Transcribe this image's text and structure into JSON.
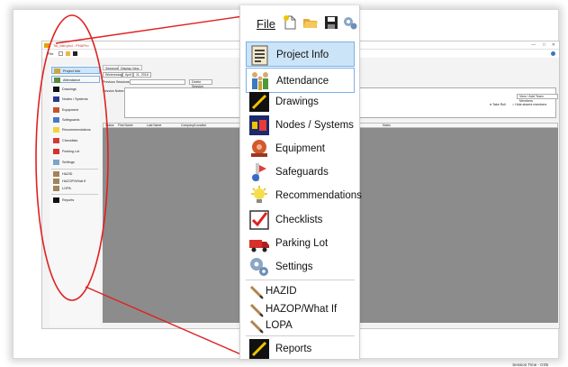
{
  "app": {
    "title": "Tst_fast.phd - PHAPro",
    "menu_file": "File",
    "window_controls": [
      "—",
      "□",
      "✕"
    ]
  },
  "nav_small": [
    {
      "label": "Project Info",
      "icon": "project-info-icon",
      "state": "active"
    },
    {
      "label": "Attendance",
      "icon": "attendance-icon",
      "state": "outlined"
    },
    {
      "label": "Drawings",
      "icon": "drawings-icon"
    },
    {
      "label": "Nodes / Systems",
      "icon": "nodes-systems-icon"
    },
    {
      "label": "Equipment",
      "icon": "equipment-icon"
    },
    {
      "label": "Safeguards",
      "icon": "safeguards-icon"
    },
    {
      "label": "Recommendations",
      "icon": "recommendations-icon"
    },
    {
      "label": "Checklists",
      "icon": "checklists-icon"
    },
    {
      "label": "Parking Lot",
      "icon": "parking-lot-icon"
    },
    {
      "label": "Settings",
      "icon": "settings-icon"
    },
    {
      "label": "HAZID",
      "icon": "pencil-icon"
    },
    {
      "label": "HAZOP/What If",
      "icon": "pencil-icon"
    },
    {
      "label": "LOPA",
      "icon": "pencil-icon"
    },
    {
      "label": "Reports",
      "icon": "reports-icon"
    }
  ],
  "content": {
    "tabs": [
      "Sessions",
      "Display View"
    ],
    "date_day": "Wednesday",
    "date_month": "April",
    "date_rest": "11, 2018",
    "previous_sessions_label": "Previous Sessions:",
    "delete_session": "Delete Session",
    "session_notes_label": "Session Notes:",
    "view_add_members": "View / Add Team Members",
    "take_roll": "Take Roll",
    "hide_absent": "Hide absent members",
    "columns": [
      "Status",
      "First Name",
      "Last Name",
      "Company/Location",
      "Notes"
    ],
    "session_time": "Session Time - 0:05"
  },
  "big_panel": {
    "file_label": "File",
    "items": [
      {
        "label": "Project Info",
        "icon": "project-info-icon",
        "state": "active"
      },
      {
        "label": "Attendance",
        "icon": "attendance-icon",
        "state": "outlined"
      },
      {
        "label": "Drawings",
        "icon": "drawings-icon"
      },
      {
        "label": "Nodes / Systems",
        "icon": "nodes-systems-icon"
      },
      {
        "label": "Equipment",
        "icon": "equipment-icon"
      },
      {
        "label": "Safeguards",
        "icon": "safeguards-icon"
      },
      {
        "label": "Recommendations",
        "icon": "recommendations-icon"
      },
      {
        "label": "Checklists",
        "icon": "checklists-icon"
      },
      {
        "label": "Parking Lot",
        "icon": "parking-lot-icon"
      },
      {
        "label": "Settings",
        "icon": "settings-icon"
      },
      {
        "label": "HAZID",
        "icon": "pencil-icon"
      },
      {
        "label": "HAZOP/What If",
        "icon": "pencil-icon"
      },
      {
        "label": "LOPA",
        "icon": "pencil-icon"
      },
      {
        "label": "Reports",
        "icon": "reports-icon"
      }
    ]
  },
  "colors": {
    "callout": "#e02020",
    "active": "#cce4f7",
    "active_border": "#7ab0e6",
    "grid": "#8c8c8c"
  }
}
